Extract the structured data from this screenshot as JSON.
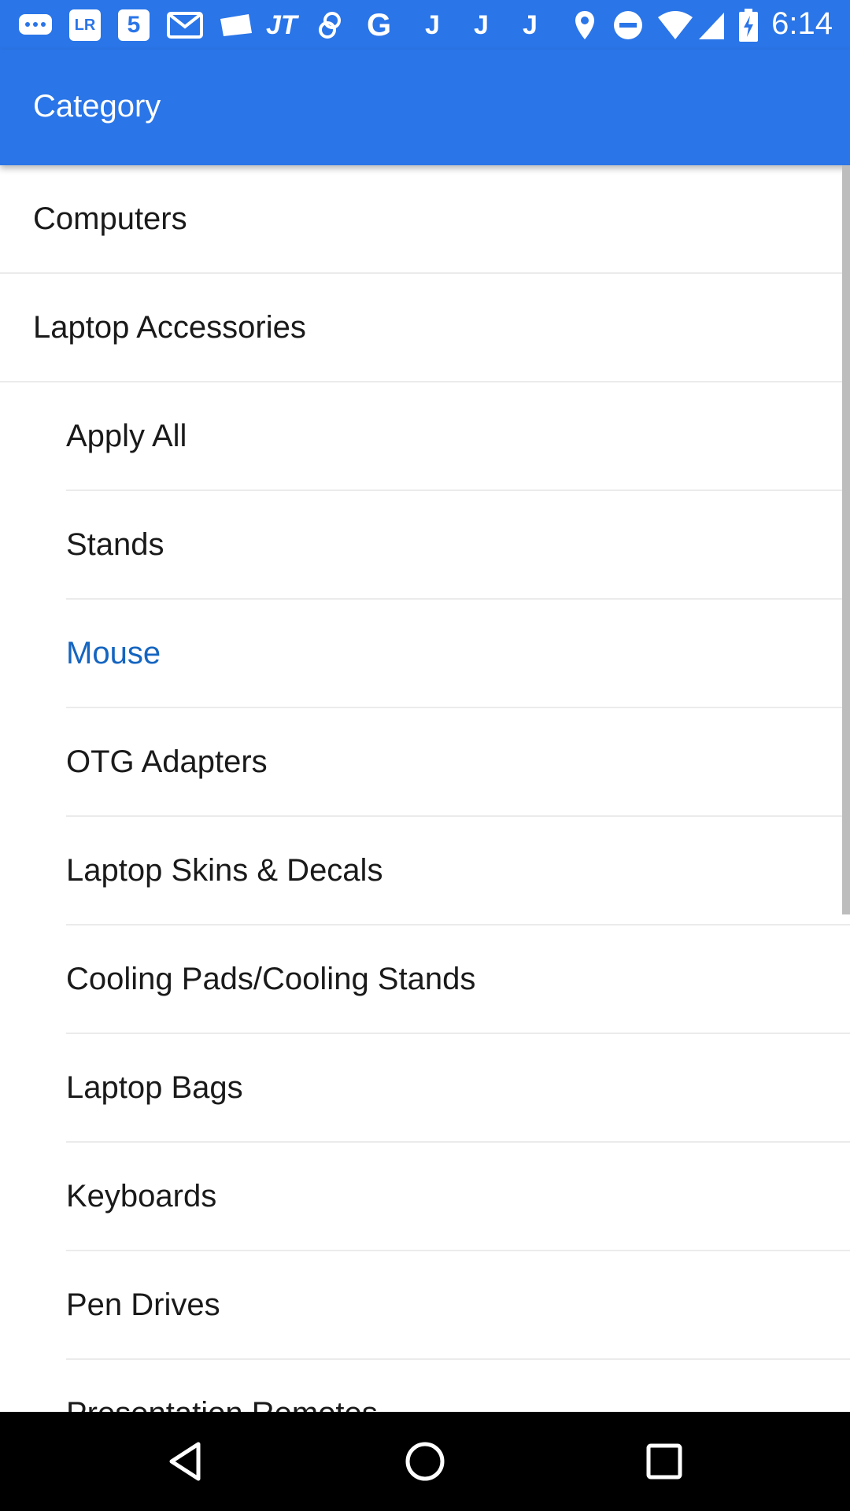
{
  "status_bar": {
    "time": "6:14",
    "notification_icons": [
      "chat-bubble-icon",
      "lr-icon",
      "five-icon",
      "gmail-icon",
      "wallet-icon",
      "jt-icon",
      "chain-link-icon",
      "g-icon",
      "j-icon",
      "j-icon",
      "j-icon"
    ],
    "system_icons": [
      "location-icon",
      "do-not-disturb-icon",
      "wifi-icon",
      "signal-icon",
      "battery-charging-icon"
    ],
    "lr_text": "LR",
    "five_text": "5",
    "jt_text": "JT",
    "g_text": "G",
    "j_text": "J"
  },
  "app_bar": {
    "title": "Category",
    "color": "#2a75e8"
  },
  "categories": [
    {
      "label": "Computers"
    },
    {
      "label": "Laptop Accessories"
    }
  ],
  "subcategories": [
    {
      "label": "Apply All",
      "selected": false
    },
    {
      "label": "Stands",
      "selected": false
    },
    {
      "label": "Mouse",
      "selected": true
    },
    {
      "label": "OTG Adapters",
      "selected": false
    },
    {
      "label": "Laptop Skins & Decals",
      "selected": false
    },
    {
      "label": "Cooling Pads/Cooling Stands",
      "selected": false
    },
    {
      "label": "Laptop Bags",
      "selected": false
    },
    {
      "label": "Keyboards",
      "selected": false
    },
    {
      "label": "Pen Drives",
      "selected": false
    },
    {
      "label": "Presentation Remotes",
      "selected": false
    }
  ],
  "colors": {
    "selected_text": "#1565c0",
    "text": "#1a1a1a"
  },
  "nav_bar": {
    "buttons": [
      "back-icon",
      "home-icon",
      "recents-icon"
    ]
  }
}
